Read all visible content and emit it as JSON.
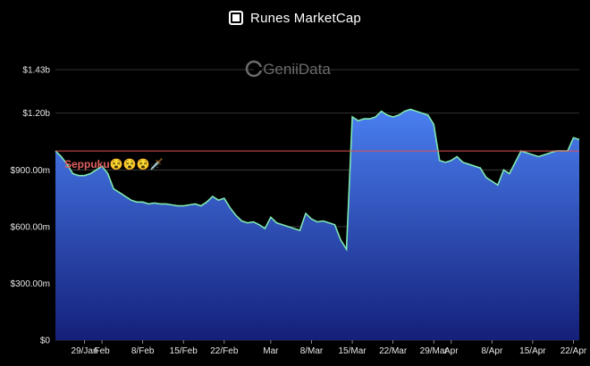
{
  "header": {
    "title": "Runes MarketCap",
    "logo_icon": "square-logo-icon"
  },
  "watermark": "GeniiData",
  "colors": {
    "background": "#000000",
    "area_top": "#4a7ff0",
    "area_bottom": "#14207a",
    "line": "#7ee8b0",
    "threshold": "#e05050",
    "grid": "#444444"
  },
  "chart_data": {
    "type": "area",
    "title": "Runes MarketCap",
    "xlabel": "",
    "ylabel": "",
    "ylim": [
      0,
      1430000000
    ],
    "yticks": [
      {
        "value": 0,
        "label": "$0"
      },
      {
        "value": 300000000,
        "label": "$300.00m"
      },
      {
        "value": 600000000,
        "label": "$600.00m"
      },
      {
        "value": 900000000,
        "label": "$900.00m"
      },
      {
        "value": 1200000000,
        "label": "$1.20b"
      },
      {
        "value": 1430000000,
        "label": "$1.43b"
      }
    ],
    "xrange": [
      "2024-01-24",
      "2024-04-23"
    ],
    "xticks": [
      {
        "date": "2024-01-29",
        "label": "29/Jan"
      },
      {
        "date": "2024-02-01",
        "label": "Feb"
      },
      {
        "date": "2024-02-08",
        "label": "8/Feb"
      },
      {
        "date": "2024-02-15",
        "label": "15/Feb"
      },
      {
        "date": "2024-02-22",
        "label": "22/Feb"
      },
      {
        "date": "2024-03-01",
        "label": "Mar"
      },
      {
        "date": "2024-03-08",
        "label": "8/Mar"
      },
      {
        "date": "2024-03-15",
        "label": "15/Mar"
      },
      {
        "date": "2024-03-22",
        "label": "22/Mar"
      },
      {
        "date": "2024-03-29",
        "label": "29/Mar"
      },
      {
        "date": "2024-04-01",
        "label": "Apr"
      },
      {
        "date": "2024-04-08",
        "label": "8/Apr"
      },
      {
        "date": "2024-04-15",
        "label": "15/Apr"
      },
      {
        "date": "2024-04-22",
        "label": "22/Apr"
      }
    ],
    "grid": true,
    "threshold": {
      "value": 1000000000,
      "label": "Seppuku😵😵😵🗡️"
    },
    "series": [
      {
        "x": [
          "2024-01-24",
          "2024-01-25",
          "2024-01-26",
          "2024-01-27",
          "2024-01-28",
          "2024-01-29",
          "2024-01-30",
          "2024-01-31",
          "2024-02-01",
          "2024-02-02",
          "2024-02-03",
          "2024-02-04",
          "2024-02-05",
          "2024-02-06",
          "2024-02-07",
          "2024-02-08",
          "2024-02-09",
          "2024-02-10",
          "2024-02-11",
          "2024-02-12",
          "2024-02-13",
          "2024-02-14",
          "2024-02-15",
          "2024-02-16",
          "2024-02-17",
          "2024-02-18",
          "2024-02-19",
          "2024-02-20",
          "2024-02-21",
          "2024-02-22",
          "2024-02-23",
          "2024-02-24",
          "2024-02-25",
          "2024-02-26",
          "2024-02-27",
          "2024-02-28",
          "2024-02-29",
          "2024-03-01",
          "2024-03-02",
          "2024-03-03",
          "2024-03-04",
          "2024-03-05",
          "2024-03-06",
          "2024-03-07",
          "2024-03-08",
          "2024-03-09",
          "2024-03-10",
          "2024-03-11",
          "2024-03-12",
          "2024-03-13",
          "2024-03-14",
          "2024-03-15",
          "2024-03-16",
          "2024-03-17",
          "2024-03-18",
          "2024-03-19",
          "2024-03-20",
          "2024-03-21",
          "2024-03-22",
          "2024-03-23",
          "2024-03-24",
          "2024-03-25",
          "2024-03-26",
          "2024-03-27",
          "2024-03-28",
          "2024-03-29",
          "2024-03-30",
          "2024-03-31",
          "2024-04-01",
          "2024-04-02",
          "2024-04-03",
          "2024-04-04",
          "2024-04-05",
          "2024-04-06",
          "2024-04-07",
          "2024-04-08",
          "2024-04-09",
          "2024-04-10",
          "2024-04-11",
          "2024-04-12",
          "2024-04-13",
          "2024-04-14",
          "2024-04-15",
          "2024-04-16",
          "2024-04-17",
          "2024-04-18",
          "2024-04-19",
          "2024-04-20",
          "2024-04-21",
          "2024-04-22",
          "2024-04-23"
        ],
        "values": [
          1000000000,
          970000000,
          930000000,
          880000000,
          870000000,
          870000000,
          880000000,
          900000000,
          920000000,
          880000000,
          800000000,
          780000000,
          760000000,
          740000000,
          730000000,
          730000000,
          720000000,
          725000000,
          720000000,
          720000000,
          715000000,
          710000000,
          710000000,
          715000000,
          720000000,
          710000000,
          730000000,
          760000000,
          740000000,
          750000000,
          700000000,
          660000000,
          630000000,
          620000000,
          625000000,
          610000000,
          590000000,
          650000000,
          620000000,
          610000000,
          600000000,
          590000000,
          580000000,
          670000000,
          640000000,
          625000000,
          630000000,
          620000000,
          610000000,
          530000000,
          480000000,
          1180000000,
          1160000000,
          1170000000,
          1170000000,
          1180000000,
          1210000000,
          1190000000,
          1180000000,
          1190000000,
          1210000000,
          1220000000,
          1210000000,
          1200000000,
          1190000000,
          1140000000,
          950000000,
          940000000,
          950000000,
          970000000,
          940000000,
          930000000,
          920000000,
          910000000,
          860000000,
          840000000,
          820000000,
          900000000,
          880000000,
          940000000,
          1000000000,
          990000000,
          980000000,
          970000000,
          980000000,
          990000000,
          1000000000,
          1000000000,
          1000000000,
          1070000000,
          1060000000
        ]
      }
    ]
  }
}
